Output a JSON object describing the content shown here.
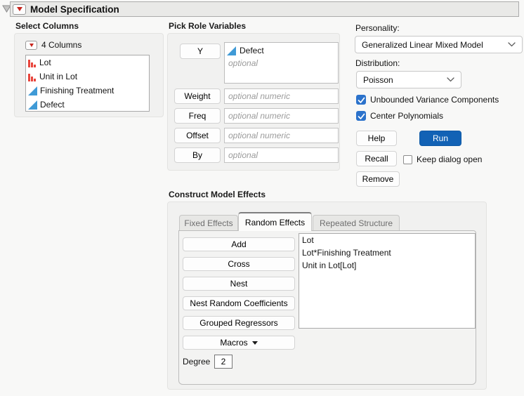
{
  "window": {
    "title": "Model Specification"
  },
  "select_columns": {
    "header": "Select Columns",
    "count_label": "4 Columns",
    "items": [
      {
        "label": "Lot",
        "icon": "nominal-bars-icon"
      },
      {
        "label": "Unit in Lot",
        "icon": "nominal-bars-icon"
      },
      {
        "label": "Finishing Treatment",
        "icon": "continuous-triangle-icon"
      },
      {
        "label": "Defect",
        "icon": "continuous-triangle-icon"
      }
    ]
  },
  "pick_roles": {
    "header": "Pick Role Variables",
    "y": {
      "button": "Y",
      "value": "Defect",
      "value_icon": "continuous-triangle-icon",
      "placeholder": "optional"
    },
    "rows": [
      {
        "button": "Weight",
        "placeholder": "optional numeric"
      },
      {
        "button": "Freq",
        "placeholder": "optional numeric"
      },
      {
        "button": "Offset",
        "placeholder": "optional numeric"
      },
      {
        "button": "By",
        "placeholder": "optional"
      }
    ]
  },
  "options": {
    "personality_label": "Personality:",
    "personality_value": "Generalized Linear Mixed Model",
    "distribution_label": "Distribution:",
    "distribution_value": "Poisson",
    "checkboxes": [
      {
        "label": "Unbounded Variance Components",
        "checked": true
      },
      {
        "label": "Center Polynomials",
        "checked": true
      }
    ],
    "help_label": "Help",
    "run_label": "Run",
    "recall_label": "Recall",
    "keep_dialog_label": "Keep dialog open",
    "keep_dialog_checked": false,
    "remove_label": "Remove"
  },
  "effects": {
    "header": "Construct Model Effects",
    "tabs": [
      {
        "label": "Fixed Effects",
        "active": false
      },
      {
        "label": "Random Effects",
        "active": true
      },
      {
        "label": "Repeated Structure",
        "active": false
      }
    ],
    "buttons": [
      "Add",
      "Cross",
      "Nest",
      "Nest Random Coefficients",
      "Grouped Regressors"
    ],
    "macros_label": "Macros",
    "degree_label": "Degree",
    "degree_value": "2",
    "list": [
      "Lot",
      "Lot*Finishing Treatment",
      "Unit in Lot[Lot]"
    ]
  },
  "colors": {
    "accent_blue": "#1262b5",
    "checkbox_blue": "#2b72cb",
    "nominal_red": "#e8453c",
    "continuous_blue": "#3f9ad6",
    "menu_triangle_red": "#c7251d"
  }
}
